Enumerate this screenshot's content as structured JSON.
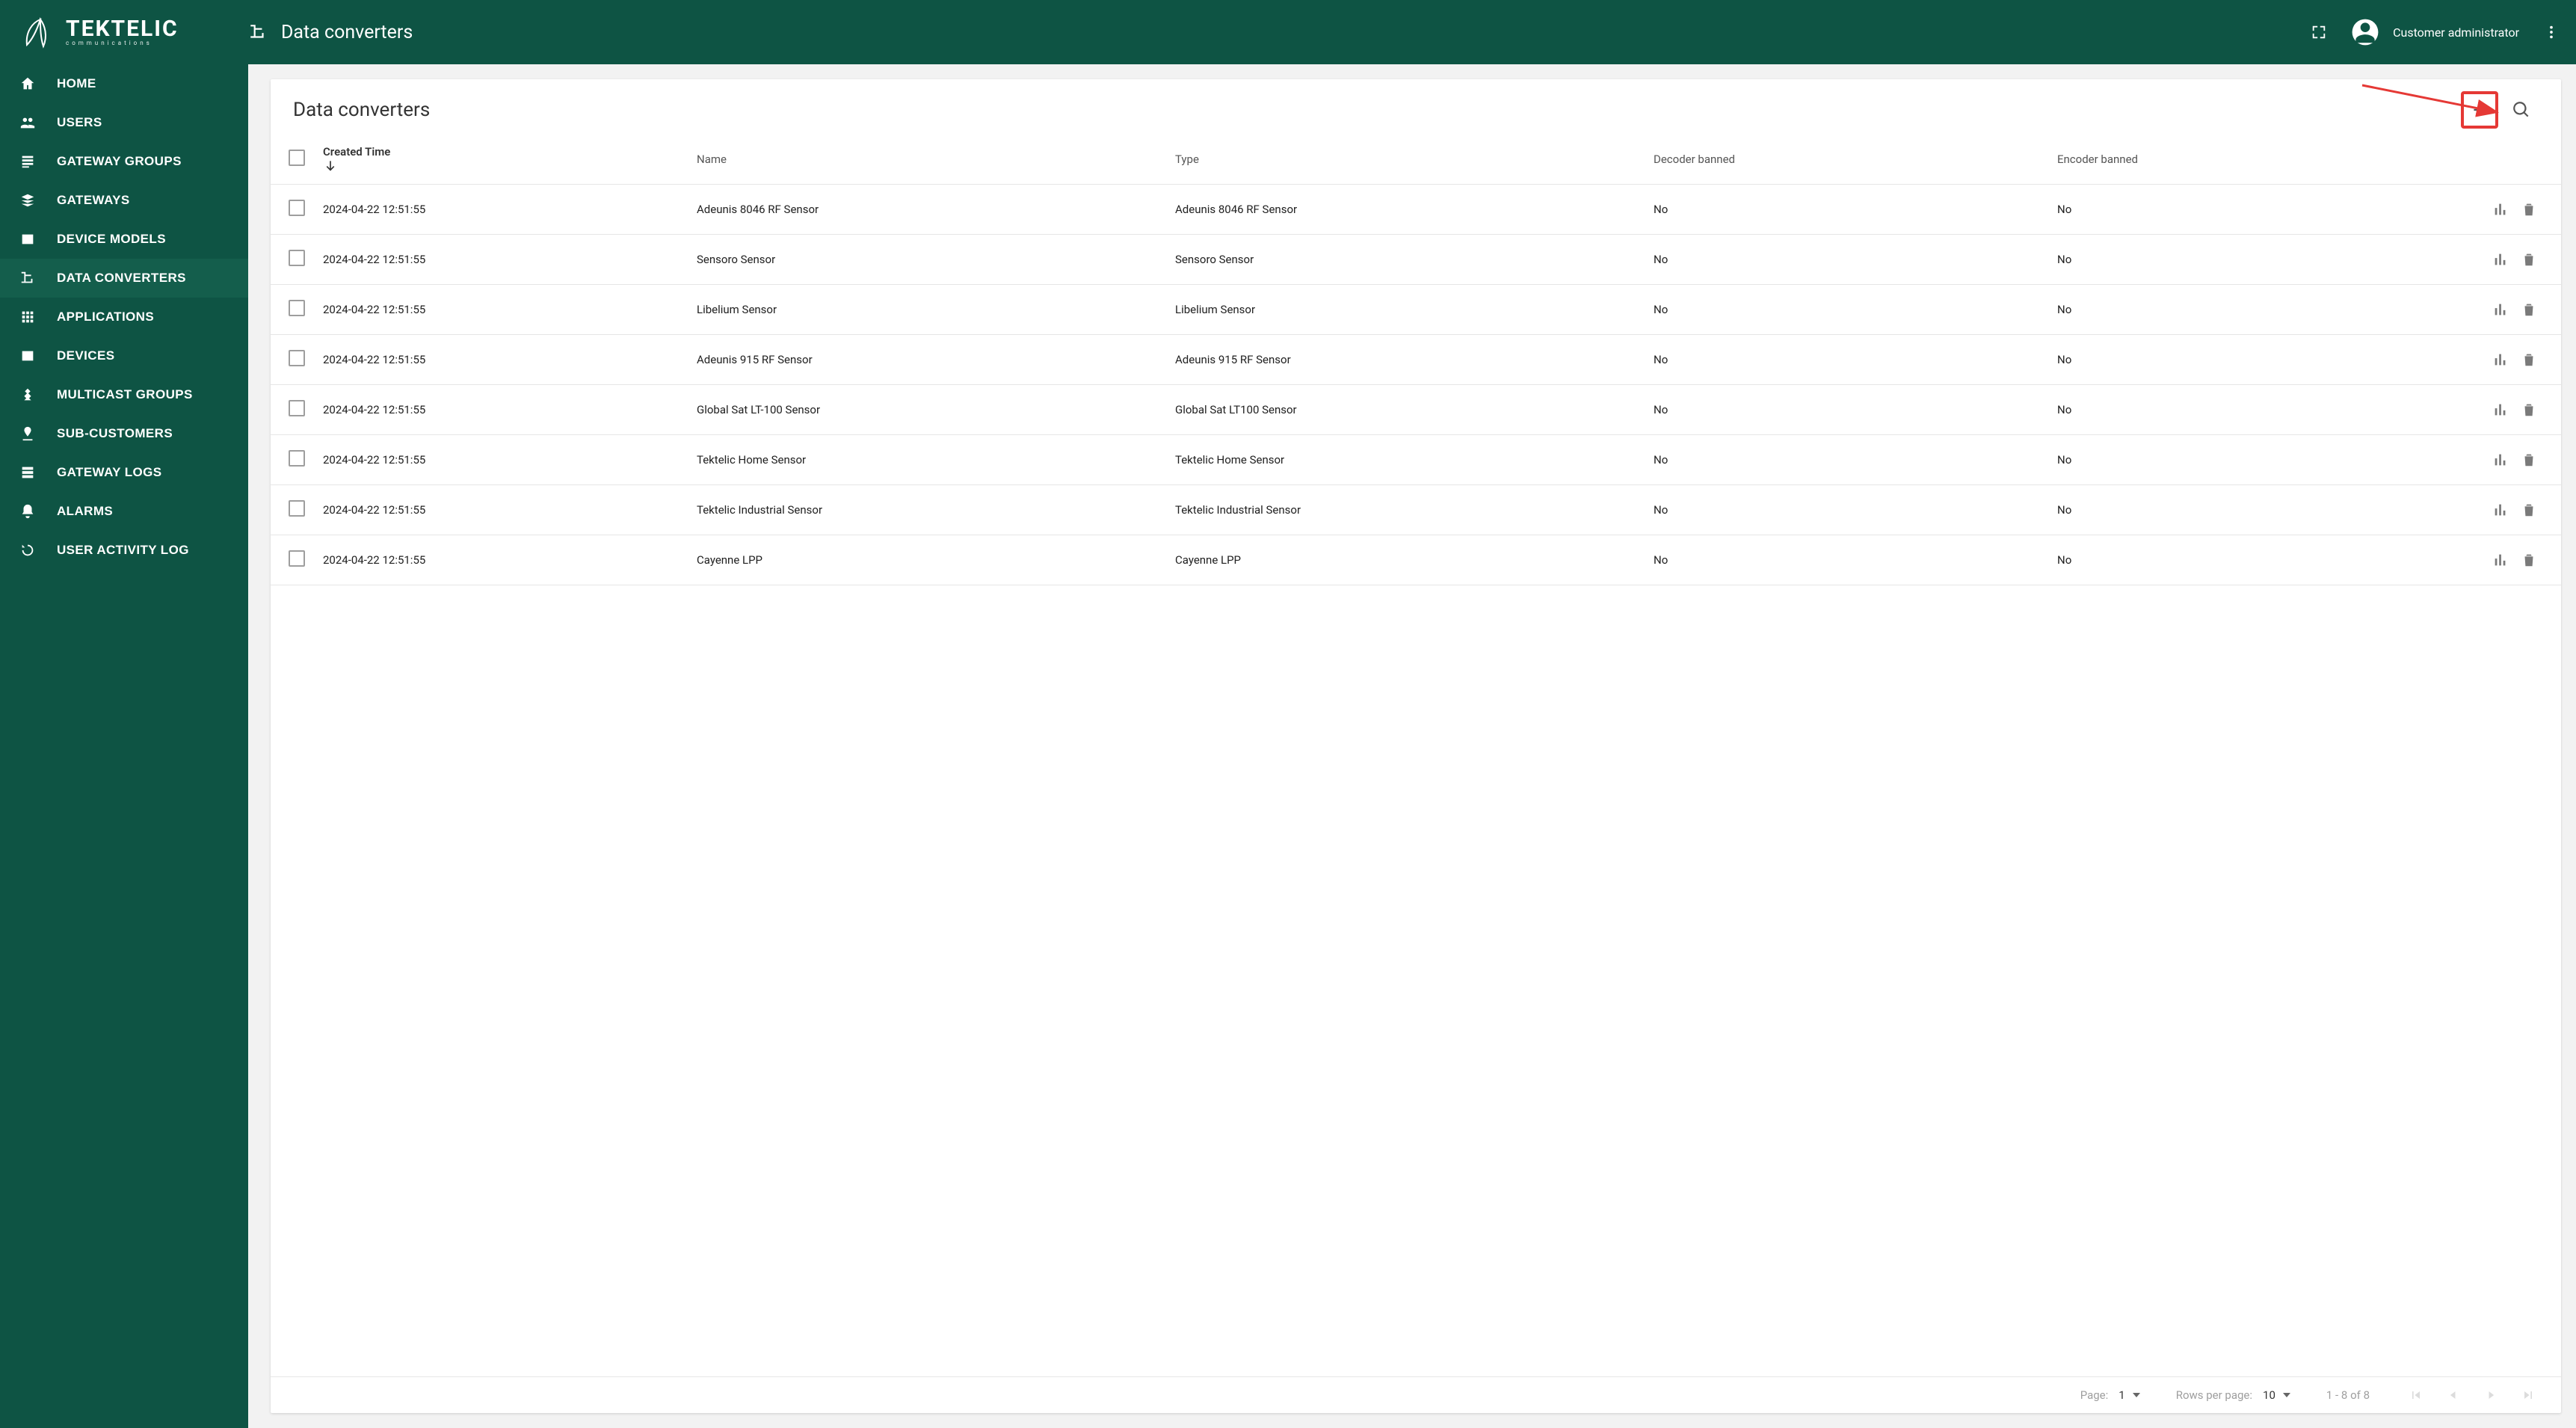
{
  "brand": {
    "name": "TEKTELIC",
    "sub": "communications"
  },
  "header": {
    "title": "Data converters",
    "role": "Customer administrator"
  },
  "sidebar": {
    "items": [
      {
        "label": "HOME"
      },
      {
        "label": "USERS"
      },
      {
        "label": "GATEWAY GROUPS"
      },
      {
        "label": "GATEWAYS"
      },
      {
        "label": "DEVICE MODELS"
      },
      {
        "label": "DATA CONVERTERS"
      },
      {
        "label": "APPLICATIONS"
      },
      {
        "label": "DEVICES"
      },
      {
        "label": "MULTICAST GROUPS"
      },
      {
        "label": "SUB-CUSTOMERS"
      },
      {
        "label": "GATEWAY LOGS"
      },
      {
        "label": "ALARMS"
      },
      {
        "label": "USER ACTIVITY LOG"
      }
    ],
    "activeIndex": 5
  },
  "card": {
    "title": "Data converters"
  },
  "table": {
    "columns": {
      "created": "Created Time",
      "name": "Name",
      "type": "Type",
      "decoder": "Decoder banned",
      "encoder": "Encoder banned"
    },
    "rows": [
      {
        "created": "2024-04-22 12:51:55",
        "name": "Adeunis 8046 RF Sensor",
        "type": "Adeunis 8046 RF Sensor",
        "decoder": "No",
        "encoder": "No"
      },
      {
        "created": "2024-04-22 12:51:55",
        "name": "Sensoro Sensor",
        "type": "Sensoro Sensor",
        "decoder": "No",
        "encoder": "No"
      },
      {
        "created": "2024-04-22 12:51:55",
        "name": "Libelium Sensor",
        "type": "Libelium Sensor",
        "decoder": "No",
        "encoder": "No"
      },
      {
        "created": "2024-04-22 12:51:55",
        "name": "Adeunis 915 RF Sensor",
        "type": "Adeunis 915 RF Sensor",
        "decoder": "No",
        "encoder": "No"
      },
      {
        "created": "2024-04-22 12:51:55",
        "name": "Global Sat LT-100 Sensor",
        "type": "Global Sat LT100 Sensor",
        "decoder": "No",
        "encoder": "No"
      },
      {
        "created": "2024-04-22 12:51:55",
        "name": "Tektelic Home Sensor",
        "type": "Tektelic Home Sensor",
        "decoder": "No",
        "encoder": "No"
      },
      {
        "created": "2024-04-22 12:51:55",
        "name": "Tektelic Industrial Sensor",
        "type": "Tektelic Industrial Sensor",
        "decoder": "No",
        "encoder": "No"
      },
      {
        "created": "2024-04-22 12:51:55",
        "name": "Cayenne LPP",
        "type": "Cayenne LPP",
        "decoder": "No",
        "encoder": "No"
      }
    ]
  },
  "pagination": {
    "pageLabel": "Page:",
    "pageValue": "1",
    "rowsLabel": "Rows per page:",
    "rowsValue": "10",
    "range": "1 - 8 of 8"
  }
}
